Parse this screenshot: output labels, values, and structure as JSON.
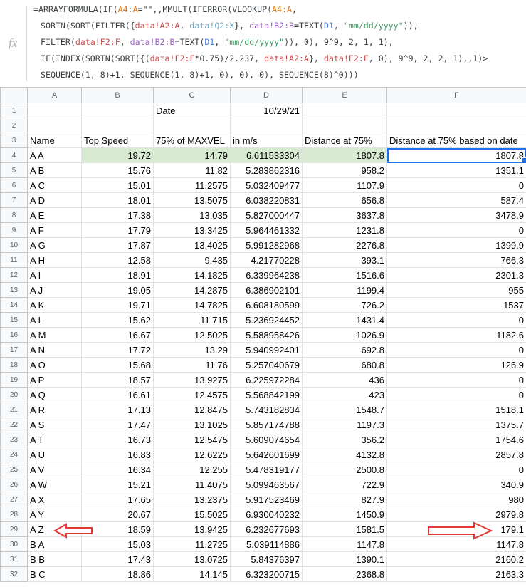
{
  "formula_bar": {
    "fx_label": "fx",
    "lines": [
      [
        [
          "=ARRAYFORMULA(IF(",
          ""
        ],
        [
          "A4:A",
          "orange"
        ],
        [
          "=\"\",,MMULT(IFERROR(VLOOKUP(",
          ""
        ],
        [
          "A4:A",
          "orange"
        ],
        [
          ",",
          ""
        ]
      ],
      [
        [
          "SORTN(SORT(FILTER({",
          ""
        ],
        [
          "data!A2:A",
          "red"
        ],
        [
          ", ",
          ""
        ],
        [
          "data!Q2:X",
          "teal"
        ],
        [
          "}, ",
          ""
        ],
        [
          "data!B2:B",
          "purple"
        ],
        [
          "=TEXT(",
          ""
        ],
        [
          "D1",
          "blue"
        ],
        [
          ", ",
          ""
        ],
        [
          "\"mm/dd/yyyy\"",
          "green"
        ],
        [
          ")),",
          ""
        ]
      ],
      [
        [
          "FILTER(",
          ""
        ],
        [
          "data!F2:F",
          "red"
        ],
        [
          ", ",
          ""
        ],
        [
          "data!B2:B",
          "purple"
        ],
        [
          "=TEXT(",
          ""
        ],
        [
          "D1",
          "blue"
        ],
        [
          ", ",
          ""
        ],
        [
          "\"mm/dd/yyyy\"",
          "green"
        ],
        [
          ")), 0), 9^9, 2, 1, 1),",
          ""
        ]
      ],
      [
        [
          "IF(INDEX(SORTN(SORT({(",
          ""
        ],
        [
          "data!F2:F",
          "red"
        ],
        [
          "*0.75)/2.237, ",
          ""
        ],
        [
          "data!A2:A",
          "red"
        ],
        [
          "}, ",
          ""
        ],
        [
          "data!F2:F",
          "red"
        ],
        [
          ", 0), 9^9, 2, 2, 1),,1)>",
          ""
        ]
      ],
      [
        [
          "SEQUENCE(1, 8)+1, SEQUENCE(1, 8)+1, 0), 0), 0), SEQUENCE(8)^0)))",
          ""
        ]
      ]
    ]
  },
  "columns": [
    "A",
    "B",
    "C",
    "D",
    "E",
    "F"
  ],
  "rows": [
    {
      "n": "1",
      "cells": [
        "",
        "",
        "Date",
        "10/29/21",
        "",
        ""
      ]
    },
    {
      "n": "2",
      "cells": [
        "",
        "",
        "",
        "",
        "",
        ""
      ]
    },
    {
      "n": "3",
      "cells": [
        "Name",
        "Top Speed",
        "75% of MAXVEL",
        "in m/s",
        "Distance at 75%",
        "Distance at 75% based on date"
      ]
    },
    {
      "n": "4",
      "cells": [
        "A A",
        "19.72",
        "14.79",
        "6.611533304",
        "1807.8",
        "1807.8"
      ]
    },
    {
      "n": "5",
      "cells": [
        "A B",
        "15.76",
        "11.82",
        "5.283862316",
        "958.2",
        "1351.1"
      ]
    },
    {
      "n": "6",
      "cells": [
        "A C",
        "15.01",
        "11.2575",
        "5.032409477",
        "1107.9",
        "0"
      ]
    },
    {
      "n": "7",
      "cells": [
        "A D",
        "18.01",
        "13.5075",
        "6.038220831",
        "656.8",
        "587.4"
      ]
    },
    {
      "n": "8",
      "cells": [
        "A E",
        "17.38",
        "13.035",
        "5.827000447",
        "3637.8",
        "3478.9"
      ]
    },
    {
      "n": "9",
      "cells": [
        "A F",
        "17.79",
        "13.3425",
        "5.964461332",
        "1231.8",
        "0"
      ]
    },
    {
      "n": "10",
      "cells": [
        "A G",
        "17.87",
        "13.4025",
        "5.991282968",
        "2276.8",
        "1399.9"
      ]
    },
    {
      "n": "11",
      "cells": [
        "A H",
        "12.58",
        "9.435",
        "4.21770228",
        "393.1",
        "766.3"
      ]
    },
    {
      "n": "12",
      "cells": [
        "A I",
        "18.91",
        "14.1825",
        "6.339964238",
        "1516.6",
        "2301.3"
      ]
    },
    {
      "n": "13",
      "cells": [
        "A J",
        "19.05",
        "14.2875",
        "6.386902101",
        "1199.4",
        "955"
      ]
    },
    {
      "n": "14",
      "cells": [
        "A K",
        "19.71",
        "14.7825",
        "6.608180599",
        "726.2",
        "1537"
      ]
    },
    {
      "n": "15",
      "cells": [
        "A L",
        "15.62",
        "11.715",
        "5.236924452",
        "1431.4",
        "0"
      ]
    },
    {
      "n": "16",
      "cells": [
        "A M",
        "16.67",
        "12.5025",
        "5.588958426",
        "1026.9",
        "1182.6"
      ]
    },
    {
      "n": "17",
      "cells": [
        "A N",
        "17.72",
        "13.29",
        "5.940992401",
        "692.8",
        "0"
      ]
    },
    {
      "n": "18",
      "cells": [
        "A O",
        "15.68",
        "11.76",
        "5.257040679",
        "680.8",
        "126.9"
      ]
    },
    {
      "n": "19",
      "cells": [
        "A P",
        "18.57",
        "13.9275",
        "6.225972284",
        "436",
        "0"
      ]
    },
    {
      "n": "20",
      "cells": [
        "A Q",
        "16.61",
        "12.4575",
        "5.568842199",
        "423",
        "0"
      ]
    },
    {
      "n": "21",
      "cells": [
        "A R",
        "17.13",
        "12.8475",
        "5.743182834",
        "1548.7",
        "1518.1"
      ]
    },
    {
      "n": "22",
      "cells": [
        "A S",
        "17.47",
        "13.1025",
        "5.857174788",
        "1197.3",
        "1375.7"
      ]
    },
    {
      "n": "23",
      "cells": [
        "A T",
        "16.73",
        "12.5475",
        "5.609074654",
        "356.2",
        "1754.6"
      ]
    },
    {
      "n": "24",
      "cells": [
        "A U",
        "16.83",
        "12.6225",
        "5.642601699",
        "4132.8",
        "2857.8"
      ]
    },
    {
      "n": "25",
      "cells": [
        "A V",
        "16.34",
        "12.255",
        "5.478319177",
        "2500.8",
        "0"
      ]
    },
    {
      "n": "26",
      "cells": [
        "A W",
        "15.21",
        "11.4075",
        "5.099463567",
        "722.9",
        "340.9"
      ]
    },
    {
      "n": "27",
      "cells": [
        "A X",
        "17.65",
        "13.2375",
        "5.917523469",
        "827.9",
        "980"
      ]
    },
    {
      "n": "28",
      "cells": [
        "A Y",
        "20.67",
        "15.5025",
        "6.930040232",
        "1450.9",
        "2979.8"
      ]
    },
    {
      "n": "29",
      "cells": [
        "A Z",
        "18.59",
        "13.9425",
        "6.232677693",
        "1581.5",
        "179.1"
      ]
    },
    {
      "n": "30",
      "cells": [
        "B A",
        "15.03",
        "11.2725",
        "5.039114886",
        "1147.8",
        "1147.8"
      ]
    },
    {
      "n": "31",
      "cells": [
        "B B",
        "17.43",
        "13.0725",
        "5.84376397",
        "1390.1",
        "2160.2"
      ]
    },
    {
      "n": "32",
      "cells": [
        "B C",
        "18.86",
        "14.145",
        "6.323200715",
        "2368.8",
        "2163.3"
      ]
    }
  ],
  "colors": {
    "highlight_row": "#d9ead3",
    "selection": "#1a73e8",
    "annotation_arrow": "#e53935"
  },
  "selected_cell": "F4",
  "highlighted_row": "4",
  "annotated_row": "29"
}
